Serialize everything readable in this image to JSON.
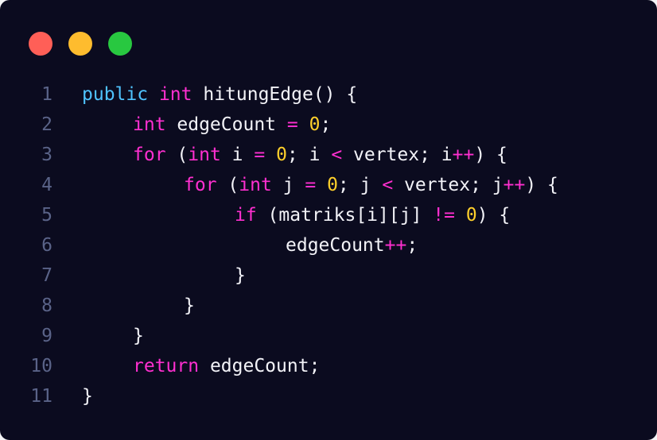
{
  "window": {
    "controls": [
      {
        "name": "close",
        "color": "#ff5f57"
      },
      {
        "name": "minimize",
        "color": "#febc2e"
      },
      {
        "name": "maximize",
        "color": "#28c840"
      }
    ]
  },
  "colors": {
    "background": "#0b0b1f",
    "line_number": "#5a6388",
    "keyword_public": "#4fc3ff",
    "keyword": "#ff2fd0",
    "number": "#ffcf2b",
    "operator": "#ff2fd0",
    "identifier": "#f2f2f7"
  },
  "code": {
    "language": "java",
    "lines": [
      {
        "number": "1",
        "indent": 0,
        "tokens": [
          [
            "kw0",
            "public"
          ],
          [
            "id",
            " "
          ],
          [
            "kw1",
            "int"
          ],
          [
            "id",
            " hitungEdge() {"
          ]
        ]
      },
      {
        "number": "2",
        "indent": 1,
        "tokens": [
          [
            "kw1",
            "int"
          ],
          [
            "id",
            " edgeCount "
          ],
          [
            "op",
            "="
          ],
          [
            "id",
            " "
          ],
          [
            "num",
            "0"
          ],
          [
            "id",
            ";"
          ]
        ]
      },
      {
        "number": "3",
        "indent": 1,
        "tokens": [
          [
            "kw1",
            "for"
          ],
          [
            "id",
            " ("
          ],
          [
            "kw1",
            "int"
          ],
          [
            "id",
            " i "
          ],
          [
            "op",
            "="
          ],
          [
            "id",
            " "
          ],
          [
            "num",
            "0"
          ],
          [
            "id",
            "; i "
          ],
          [
            "op",
            "<"
          ],
          [
            "id",
            " vertex; i"
          ],
          [
            "op",
            "++"
          ],
          [
            "id",
            ") {"
          ]
        ]
      },
      {
        "number": "4",
        "indent": 2,
        "tokens": [
          [
            "kw1",
            "for"
          ],
          [
            "id",
            " ("
          ],
          [
            "kw1",
            "int"
          ],
          [
            "id",
            " j "
          ],
          [
            "op",
            "="
          ],
          [
            "id",
            " "
          ],
          [
            "num",
            "0"
          ],
          [
            "id",
            "; j "
          ],
          [
            "op",
            "<"
          ],
          [
            "id",
            " vertex; j"
          ],
          [
            "op",
            "++"
          ],
          [
            "id",
            ") {"
          ]
        ]
      },
      {
        "number": "5",
        "indent": 3,
        "tokens": [
          [
            "kw1",
            "if"
          ],
          [
            "id",
            " (matriks[i][j] "
          ],
          [
            "op",
            "!="
          ],
          [
            "id",
            " "
          ],
          [
            "num",
            "0"
          ],
          [
            "id",
            ") {"
          ]
        ]
      },
      {
        "number": "6",
        "indent": 4,
        "tokens": [
          [
            "id",
            "edgeCount"
          ],
          [
            "op",
            "++"
          ],
          [
            "id",
            ";"
          ]
        ]
      },
      {
        "number": "7",
        "indent": 3,
        "tokens": [
          [
            "id",
            "}"
          ]
        ]
      },
      {
        "number": "8",
        "indent": 2,
        "tokens": [
          [
            "id",
            "}"
          ]
        ]
      },
      {
        "number": "9",
        "indent": 1,
        "tokens": [
          [
            "id",
            "}"
          ]
        ]
      },
      {
        "number": "10",
        "indent": 1,
        "tokens": [
          [
            "kw1",
            "return"
          ],
          [
            "id",
            " edgeCount;"
          ]
        ]
      },
      {
        "number": "11",
        "indent": 0,
        "tokens": [
          [
            "id",
            "}"
          ]
        ]
      }
    ]
  }
}
